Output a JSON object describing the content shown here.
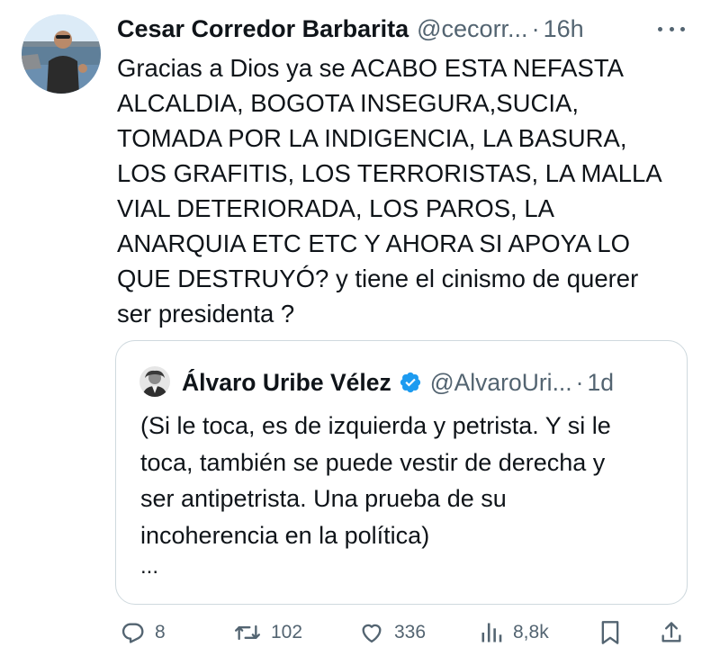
{
  "tweet": {
    "author_name": "Cesar Corredor Barbarita",
    "handle": "@cecorr...",
    "separator": "·",
    "time": "16h",
    "text": "Gracias a Dios ya se  ACABO ESTA NEFASTA\nALCALDIA, BOGOTA INSEGURA,SUCIA,\nTOMADA POR LA INDIGENCIA, LA BASURA,\nLOS GRAFITIS, LOS TERRORISTAS, LA MALLA\nVIAL DETERIORADA, LOS PAROS, LA\nANARQUIA  ETC ETC Y AHORA SI APOYA LO\nQUE DESTRUYÓ? y tiene el cinismo de querer\nser presidenta ?"
  },
  "quote": {
    "author_name": "Álvaro Uribe Vélez",
    "handle": "@AlvaroUri...",
    "separator": "·",
    "time": "1d",
    "text": "(Si le toca, es de izquierda y petrista. Y si le\ntoca, también se puede vestir de derecha y\nser antipetrista. Una prueba de su\nincoherencia en la política)",
    "ellipsis": "..."
  },
  "actions": {
    "replies": "8",
    "reposts": "102",
    "likes": "336",
    "views": "8,8k"
  },
  "icons": {
    "reply": "reply-icon",
    "repost": "repost-icon",
    "like": "heart-icon",
    "views": "views-icon",
    "bookmark": "bookmark-icon",
    "share": "share-icon",
    "verified": "verified-badge-icon",
    "more": "more-icon"
  },
  "colors": {
    "text": "#0f1419",
    "secondary": "#536471",
    "verified": "#1d9bf0",
    "border": "#cfd9de"
  }
}
